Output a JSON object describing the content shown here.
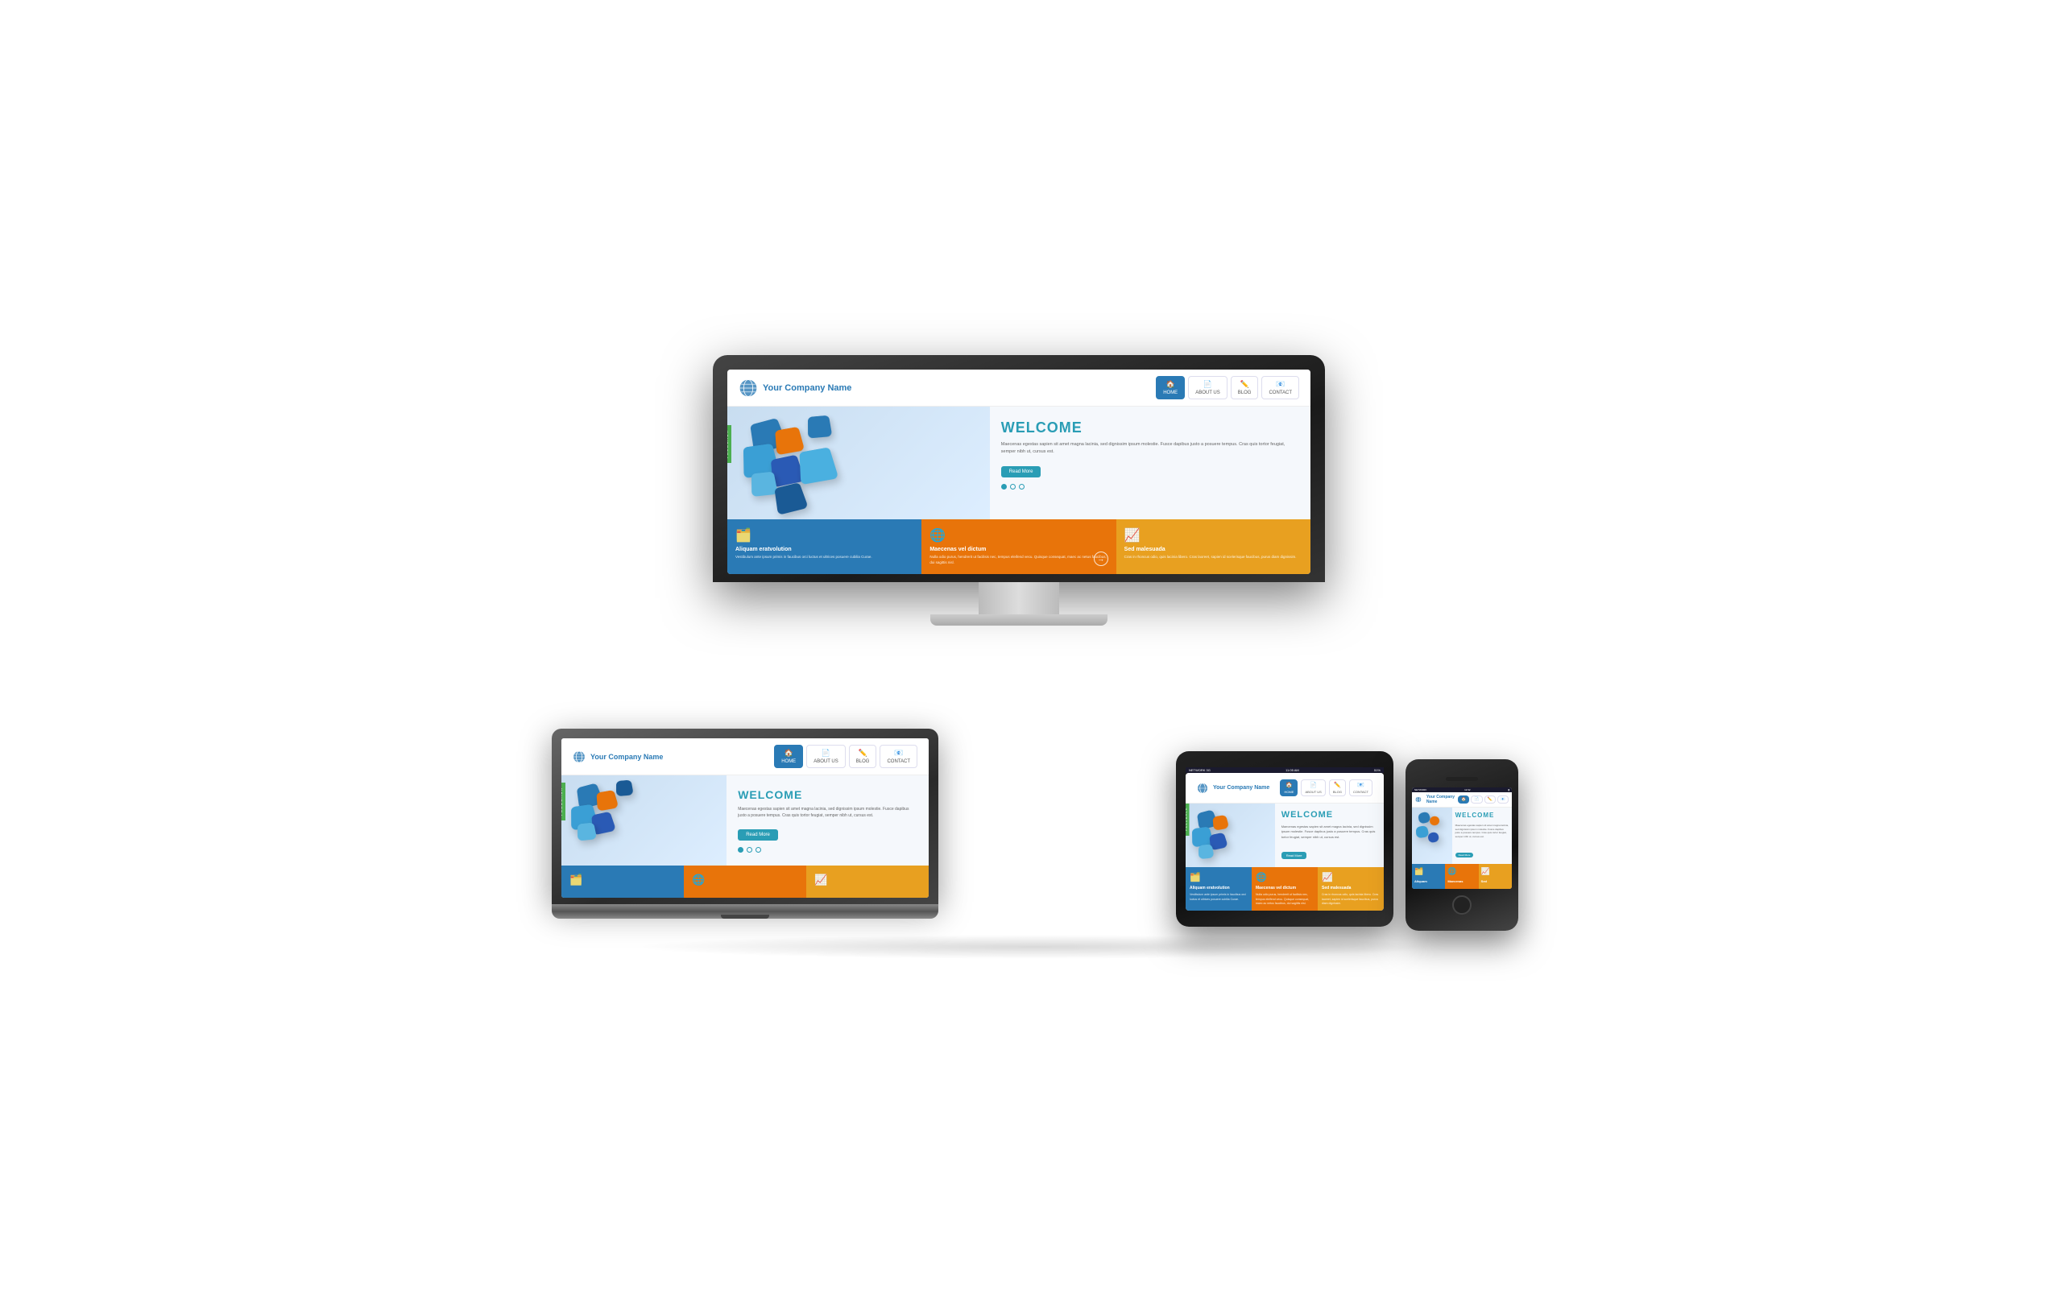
{
  "site": {
    "logo_text": "Your Company Name",
    "tagline": "Your Company Name",
    "nav": [
      {
        "label": "HOME",
        "icon": "🏠",
        "active": true
      },
      {
        "label": "ABOUT US",
        "icon": "📄",
        "active": false
      },
      {
        "label": "BLOG",
        "icon": "✏️",
        "active": false
      },
      {
        "label": "CONTACT",
        "icon": "📧",
        "active": false
      }
    ],
    "hero": {
      "title": "WELCOME",
      "text": "Maecenas egestas sapien sit amet magna lacinia, sed dignissim ipsum molestie. Fusce dapibus justo a posuere tempus. Cras quis tortor feugiat, semper nibh ut, cursus est.",
      "button": "Read More"
    },
    "features": [
      {
        "title": "Aliquam eratvolution",
        "text": "Vestibulum ante ipsum primis in faucibus orci luctus et ultrices posuere cubilia Curae.",
        "color": "blue",
        "icon": "🗂️"
      },
      {
        "title": "Maecenas vel dictum",
        "text": "Nulla odio purus, hendrerit ut facilisis nec, tempus eleifend vecu. Quisque consequat, maec ac netus faucibus, dui sagittis nisl.",
        "color": "orange",
        "icon": "🌐"
      },
      {
        "title": "Sed malesuada",
        "text": "Cras in rhoncus odio, quis lacinia libero. Cras laoreet, sapien id scelerisque faucibus, purus diam dignissim.",
        "color": "yellow",
        "icon": "📈"
      }
    ],
    "feedback_tab": "FEEDBACK",
    "dots": [
      "active",
      "inactive",
      "inactive"
    ]
  },
  "status_bar": {
    "network": "NETWORK 3G",
    "time": "11:05 AM",
    "battery": "51%"
  },
  "phone_status_bar": {
    "network": "NETWORK",
    "time": "12:32",
    "battery": "▮"
  }
}
